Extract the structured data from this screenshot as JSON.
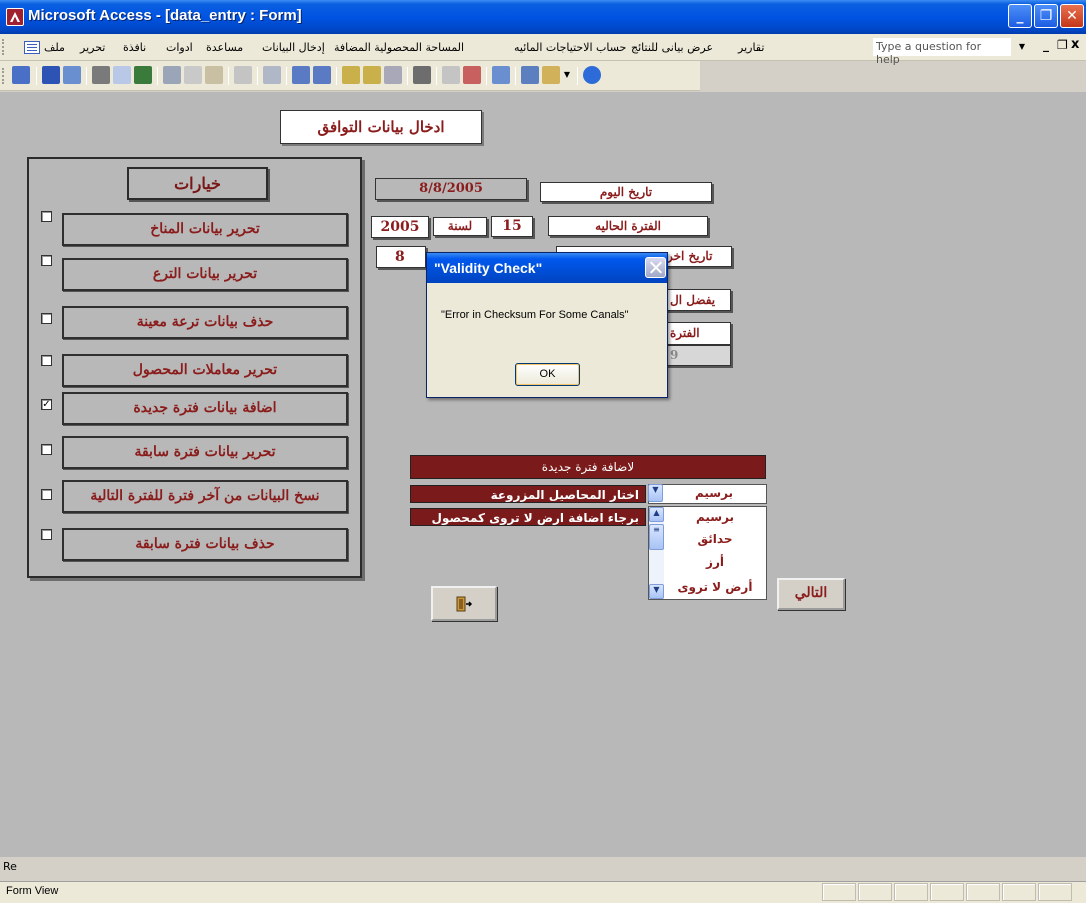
{
  "window": {
    "title": "Microsoft Access - [data_entry : Form]"
  },
  "menu": {
    "items": [
      "ملف",
      "تحرير",
      "نافذة",
      "ادوات",
      "مساعدة",
      "إدخال البيانات",
      "المساحة المحصولية المضافة",
      "حساب الاحتياجات المائيه",
      "عرض بيانى للنتائج",
      "تقارير"
    ],
    "help_placeholder": "Type a question for help"
  },
  "form": {
    "title": "ادخال بيانات التوافق",
    "options_header": "خيارات",
    "options": [
      {
        "label": "تحرير بيانات المناخ",
        "checked": false
      },
      {
        "label": "تحرير بيانات الترع",
        "checked": false
      },
      {
        "label": "حذف بيانات ترعة معينة",
        "checked": false
      },
      {
        "label": "تحرير معاملات المحصول",
        "checked": false
      },
      {
        "label": "اضافة بيانات فترة جديدة",
        "checked": true
      },
      {
        "label": "تحرير بيانات فترة سابقة",
        "checked": false
      },
      {
        "label": "نسخ البيانات من آخر فترة للفترة التالية",
        "checked": false
      },
      {
        "label": "حذف بيانات فترة سابقة",
        "checked": false
      }
    ],
    "today_label": "تاريخ اليوم",
    "today_value": "8/8/2005",
    "current_period_label": "الفترة الحاليه",
    "period_value": "15",
    "year_label": "لسنة",
    "year_value": "2005",
    "row3_label": "تاريخ اخر",
    "row3_value": "8",
    "row4_label": "يفضل ال",
    "row5_label": "الفترة",
    "row5_value": "9",
    "add_period_header": "لاضافة فترة جديدة",
    "crop_select_label": "اختار المحاصيل المزروعة",
    "no_irrigation_label": "برجاء اضافة ارض لا تروى كمحصول",
    "crop_selected": "برسيم",
    "crop_list": [
      "برسيم",
      "حدائق",
      "أرز",
      "أرض لا تروى"
    ],
    "next_button": "التالي"
  },
  "dialog": {
    "title": "\"Validity Check\"",
    "message": "\"Error in Checksum For Some Canals\"",
    "ok_label": "OK"
  },
  "status": {
    "strip_text": "Re",
    "mode": "Form View"
  },
  "colors": {
    "title_bar": "#0054e3",
    "dark_red": "#7a1a1a",
    "label_red": "#8b1c1c",
    "workspace": "#b8b8b8"
  }
}
